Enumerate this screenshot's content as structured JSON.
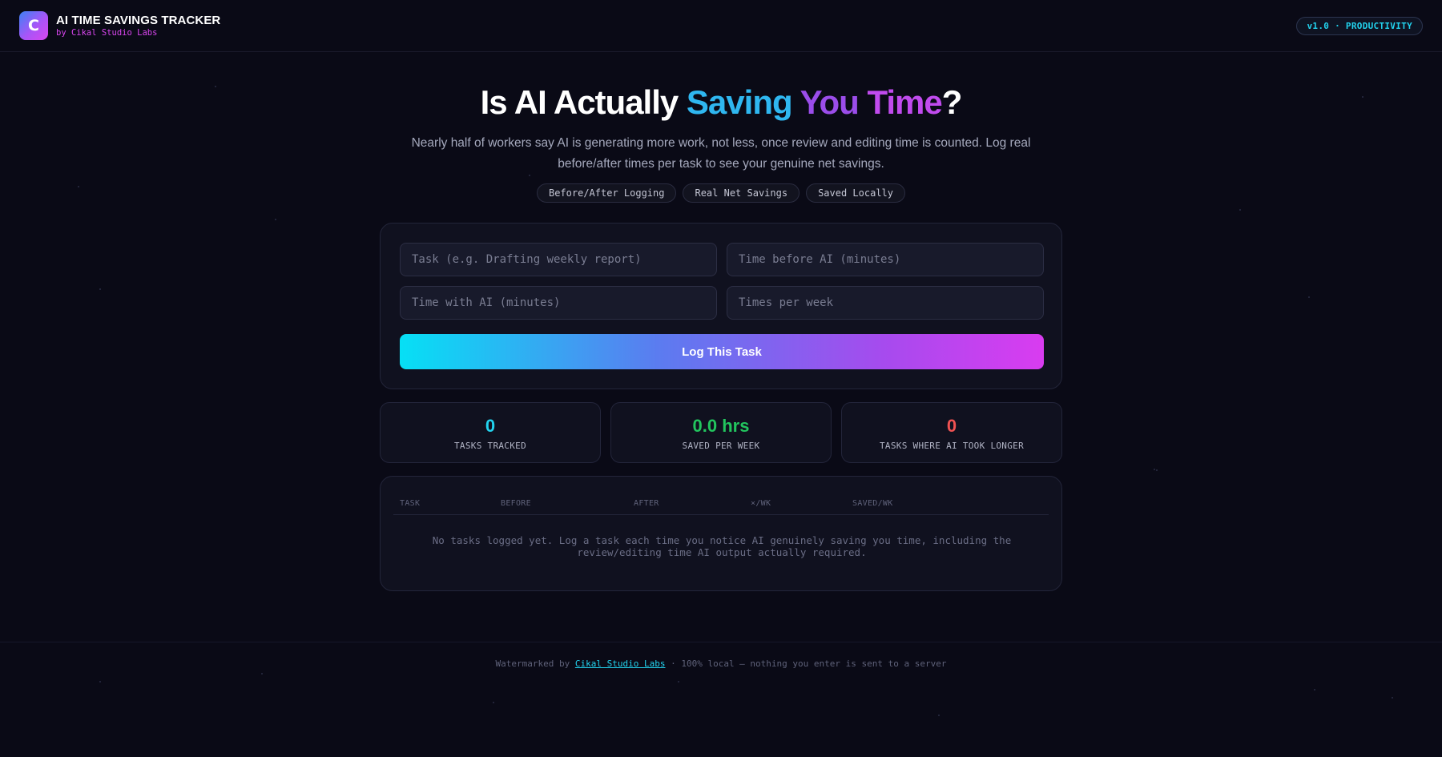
{
  "header": {
    "logo_letter": "C",
    "title": "AI TIME SAVINGS TRACKER",
    "subtitle": "by Cikal Studio Labs",
    "version_badge": "v1.0 · PRODUCTIVITY"
  },
  "hero": {
    "title_prefix": "Is AI Actually ",
    "title_word1": "Saving",
    "title_space": " ",
    "title_word2": "You",
    "title_space2": " ",
    "title_word3": "Time",
    "title_suffix": "?",
    "description": "Nearly half of workers say AI is generating more work, not less, once review and editing time is counted. Log real before/after times per task to see your genuine net savings.",
    "chips": [
      "Before/After Logging",
      "Real Net Savings",
      "Saved Locally"
    ]
  },
  "form": {
    "task_placeholder": "Task (e.g. Drafting weekly report)",
    "before_placeholder": "Time before AI (minutes)",
    "with_placeholder": "Time with AI (minutes)",
    "times_placeholder": "Times per week",
    "submit_label": "Log This Task"
  },
  "stats": [
    {
      "value": "0",
      "label": "TASKS TRACKED",
      "color": "#22d3ee"
    },
    {
      "value": "0.0 hrs",
      "label": "SAVED PER WEEK",
      "color": "#22c55e"
    },
    {
      "value": "0",
      "label": "TASKS WHERE AI TOOK LONGER",
      "color": "#f05252"
    }
  ],
  "table": {
    "columns": [
      "TASK",
      "BEFORE",
      "AFTER",
      "×/WK",
      "SAVED/WK"
    ],
    "rows": [],
    "empty_message": "No tasks logged yet. Log a task each time you notice AI genuinely saving you time, including the review/editing time AI output actually required."
  },
  "footer": {
    "prefix": "Watermarked by ",
    "link_text": "Cikal Studio Labs",
    "suffix": " · 100% local — nothing you enter is sent to a server"
  },
  "colors": {
    "background": "#0a0a16",
    "accent_cyan": "#22d3ee",
    "accent_magenta": "#d946ef",
    "positive": "#22c55e",
    "negative": "#f05252"
  }
}
